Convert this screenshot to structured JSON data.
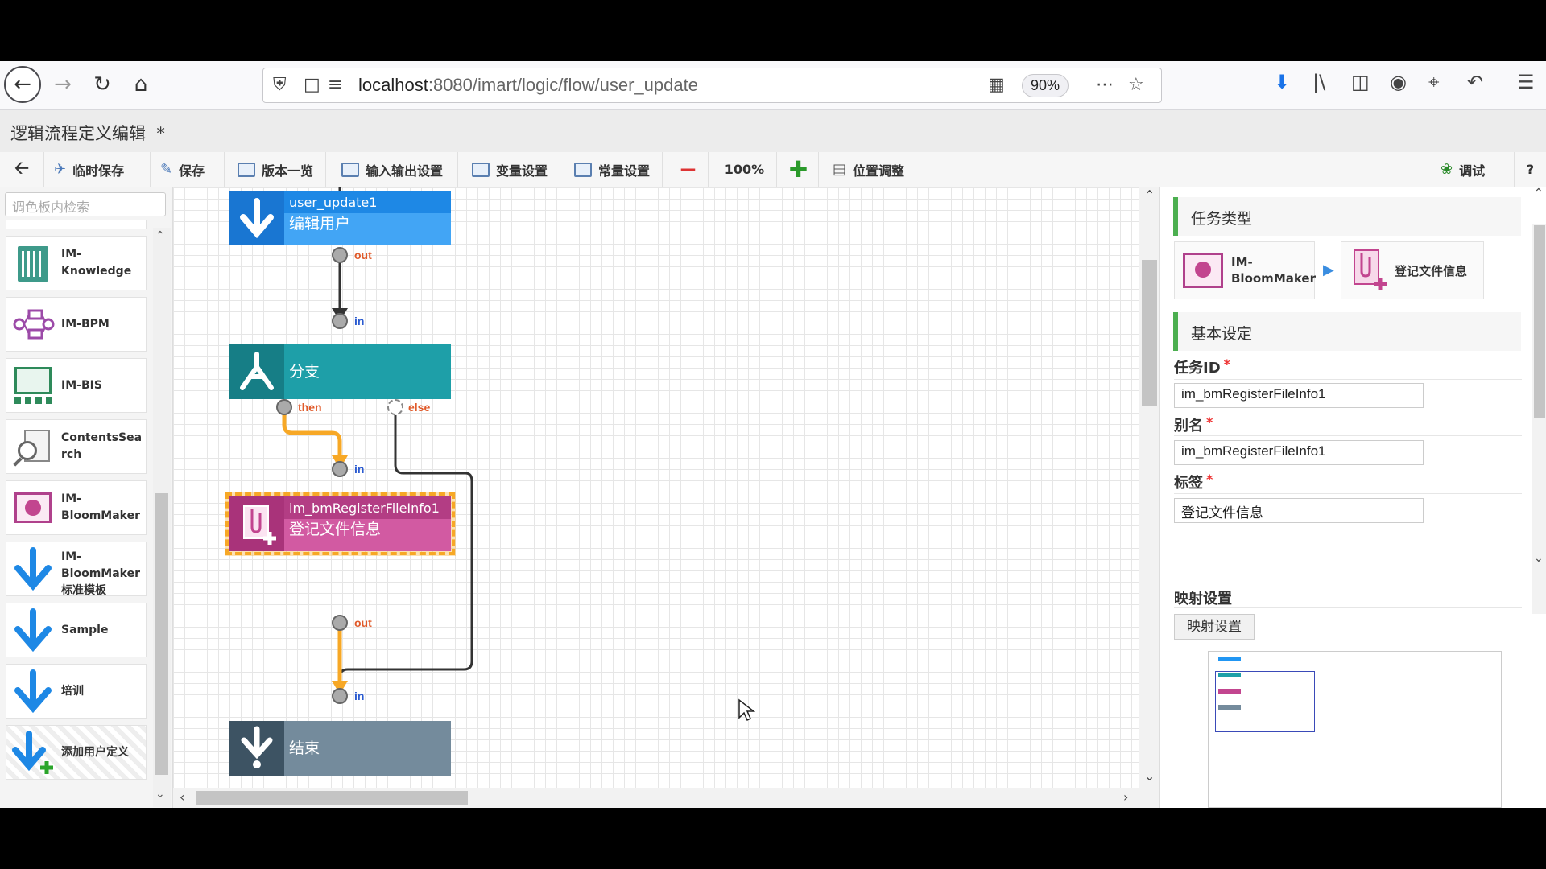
{
  "browser": {
    "url_host": "localhost",
    "url_path": ":8080/imart/logic/flow/user_update",
    "zoom": "90%"
  },
  "app": {
    "title": "逻辑流程定义编辑",
    "modified_mark": "*"
  },
  "toolbar": {
    "temp_save": "临时保存",
    "save": "保存",
    "version_list": "版本一览",
    "io_settings": "输入输出设置",
    "var_settings": "变量设置",
    "const_settings": "常量设置",
    "zoom_level": "100%",
    "position_adjust": "位置调整",
    "debug": "调试",
    "help": "?"
  },
  "palette": {
    "search_placeholder": "调色板内检索",
    "items": [
      {
        "label": "IM-Knowledge"
      },
      {
        "label": "IM-BPM"
      },
      {
        "label": "IM-BIS"
      },
      {
        "label": "ContentsSearch"
      },
      {
        "label": "IM-BloomMaker"
      },
      {
        "label": "IM-BloomMaker标准模板"
      },
      {
        "label": "Sample"
      },
      {
        "label": "培训"
      },
      {
        "label": "添加用户定义"
      }
    ]
  },
  "flow": {
    "start": {
      "id": "user_update1",
      "label": "编辑用户",
      "color": "#2196f3"
    },
    "branch": {
      "label": "分支",
      "color": "#1e9fa8"
    },
    "task": {
      "id": "im_bmRegisterFileInfo1",
      "label": "登记文件信息",
      "color": "#c2458f"
    },
    "end": {
      "label": "结束",
      "color": "#748b9c"
    },
    "ports": {
      "out": "out",
      "in": "in",
      "then": "then",
      "else": "else"
    }
  },
  "props": {
    "task_type_header": "任务类型",
    "task_type_parent": "IM-BloomMaker",
    "task_type_child": "登记文件信息",
    "basic_header": "基本设定",
    "task_id_label": "任务ID",
    "task_id_value": "im_bmRegisterFileInfo1",
    "alias_label": "别名",
    "alias_value": "im_bmRegisterFileInfo1",
    "tag_label": "标签",
    "tag_value": "登记文件信息",
    "mapping_label": "映射设置",
    "mapping_button": "映射设置",
    "required_mark": "*"
  }
}
